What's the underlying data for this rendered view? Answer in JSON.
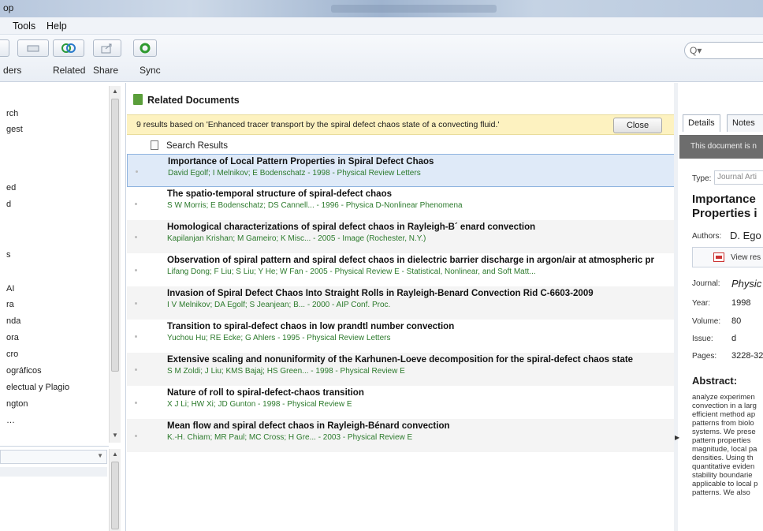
{
  "window": {
    "title_fragment": "op"
  },
  "menu": {
    "tools": "Tools",
    "help": "Help"
  },
  "toolbar": {
    "folders_label": "ders",
    "related_label": "Related",
    "share_label": "Share",
    "sync_label": "Sync",
    "search_placeholder": "Q▾"
  },
  "sidebar": {
    "items": [
      "rch",
      "gest",
      "ed",
      "d",
      "s",
      "AI",
      "ra",
      "nda",
      "ora",
      "cro",
      "ográficos",
      "electual y Plagio",
      "ngton",
      "…"
    ]
  },
  "related": {
    "header": "Related Documents",
    "info": "9 results based on 'Enhanced tracer transport by the spiral defect chaos state of a convecting fluid.'",
    "close_label": "Close",
    "results_label": "Search Results",
    "results": [
      {
        "title": "Importance of Local Pattern Properties in Spiral Defect Chaos",
        "meta": "David Egolf; I Melnikov; E Bodenschatz - 1998 - Physical Review Letters"
      },
      {
        "title": "The spatio-temporal structure of spiral-defect chaos",
        "meta": "S W Morris; E Bodenschatz; DS Cannell... - 1996 - Physica D-Nonlinear Phenomena"
      },
      {
        "title": "Homological characterizations of spiral defect chaos in Rayleigh-B´ enard convection",
        "meta": "Kapilanjan Krishan; M Gameiro; K Misc... - 2005 - Image (Rochester, N.Y.)"
      },
      {
        "title": "Observation of spiral pattern and spiral defect chaos in dielectric barrier discharge in argon/air at atmospheric pr",
        "meta": "Lifang Dong; F Liu; S Liu; Y He; W Fan - 2005 - Physical Review E - Statistical, Nonlinear, and Soft Matt..."
      },
      {
        "title": "Invasion of Spiral Defect Chaos Into Straight Rolls in Rayleigh-Benard Convection Rid C-6603-2009",
        "meta": "I V Melnikov; DA Egolf; S Jeanjean; B... - 2000 - AIP Conf. Proc."
      },
      {
        "title": "Transition to spiral-defect chaos in low prandtl number convection",
        "meta": "Yuchou Hu; RE Ecke; G Ahlers - 1995 - Physical Review Letters"
      },
      {
        "title": "Extensive scaling and nonuniformity of the Karhunen-Loeve decomposition for the spiral-defect chaos state",
        "meta": "S M Zoldi; J Liu; KMS Bajaj; HS Green... - 1998 - Physical Review E"
      },
      {
        "title": "Nature of roll to spiral-defect-chaos transition",
        "meta": "X J Li; HW Xi; JD Gunton - 1998 - Physical Review E"
      },
      {
        "title": "Mean flow and spiral defect chaos in Rayleigh-Bénard convection",
        "meta": "K.-H. Chiam; MR Paul; MC Cross; H Gre... - 2003 - Physical Review E"
      }
    ]
  },
  "details": {
    "tab_details": "Details",
    "tab_notes": "Notes",
    "banner": "This document is n",
    "type_label": "Type:",
    "type_value": "Journal Arti",
    "title_line1": "Importance",
    "title_line2": "Properties i",
    "authors_label": "Authors:",
    "authors_value": "D. Ego",
    "view_label": "View res",
    "journal_label": "Journal:",
    "journal_value": "Physic",
    "year_label": "Year:",
    "year_value": "1998",
    "volume_label": "Volume:",
    "volume_value": "80",
    "issue_label": "Issue:",
    "issue_value": "d",
    "pages_label": "Pages:",
    "pages_value": "3228-32",
    "abstract_head": "Abstract:",
    "abstract_lines": [
      "analyze experimen",
      "convection in a larg",
      "efficient method ap",
      "patterns from biolo",
      "systems. We prese",
      "pattern properties",
      "magnitude, local pa",
      "densities. Using th",
      "quantitative eviden",
      "stability boundarie",
      "applicable to local p",
      "patterns. We also"
    ]
  }
}
